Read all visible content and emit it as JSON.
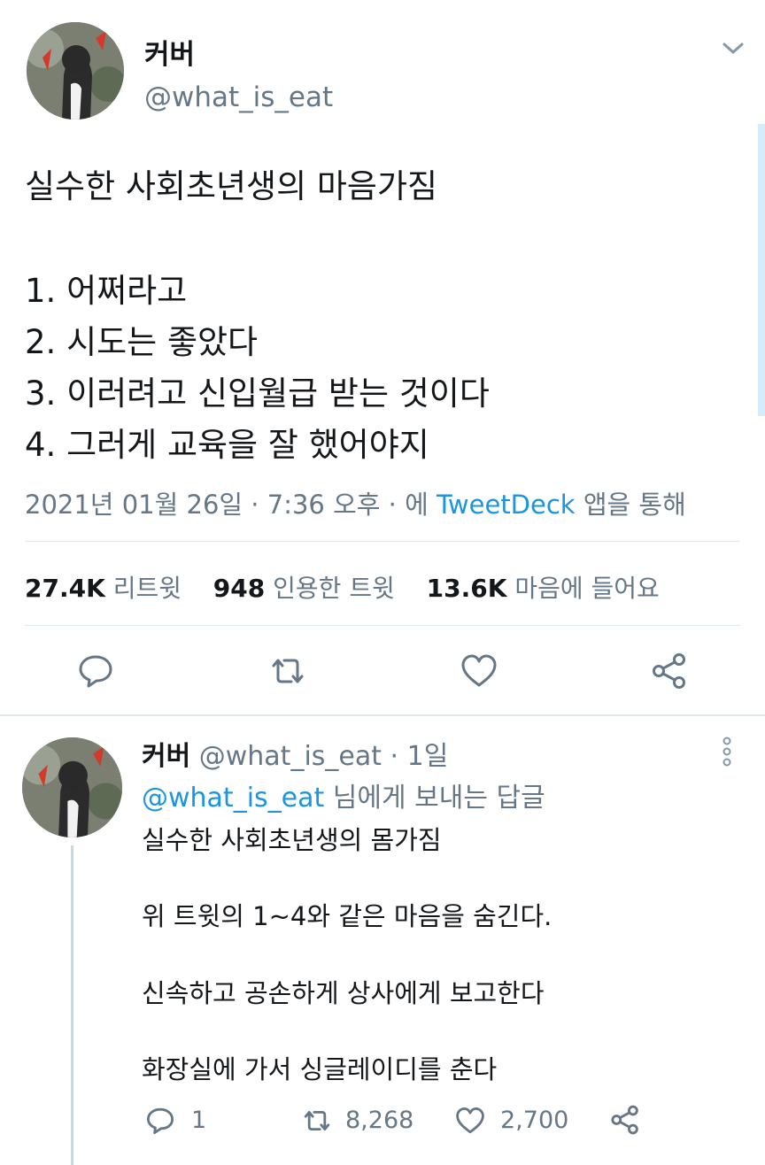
{
  "main_tweet": {
    "author_name": "커버",
    "author_handle": "@what_is_eat",
    "title_line": "실수한 사회초년생의 마음가짐",
    "lines": [
      "1. 어쩌라고",
      "2. 시도는 좋았다",
      "3. 이러려고 신입월급 받는 것이다",
      "4. 그러게 교육을 잘 했어야지"
    ],
    "meta_date": "2021년 01월 26일 · 7:36 오후 · 에 ",
    "meta_source": "TweetDeck",
    "meta_suffix": " 앱을 통해",
    "stats": {
      "retweets_count": "27.4K",
      "retweets_label": "리트윗",
      "quotes_count": "948",
      "quotes_label": "인용한 트윗",
      "likes_count": "13.6K",
      "likes_label": "마음에 들어요"
    }
  },
  "reply": {
    "author_name": "커버",
    "author_handle": "@what_is_eat · 1일",
    "reply_to_handle": "@what_is_eat",
    "reply_to_suffix": " 님에게 보내는 답글",
    "lines": [
      "실수한 사회초년생의 몸가짐",
      "위 트윗의 1~4와 같은 마음을 숨긴다.",
      "신속하고 공손하게 상사에게 보고한다",
      "화장실에 가서 싱글레이디를 춘다"
    ],
    "actions": {
      "reply_count": "1",
      "retweet_count": "8,268",
      "like_count": "2,700"
    }
  },
  "colors": {
    "link": "#1b95e0",
    "muted": "#657786",
    "text": "#14171a",
    "divider": "#e1e8ed"
  },
  "icons": [
    "chevron-down-icon",
    "reply-icon",
    "retweet-icon",
    "heart-icon",
    "share-icon",
    "more-vertical-icon"
  ]
}
